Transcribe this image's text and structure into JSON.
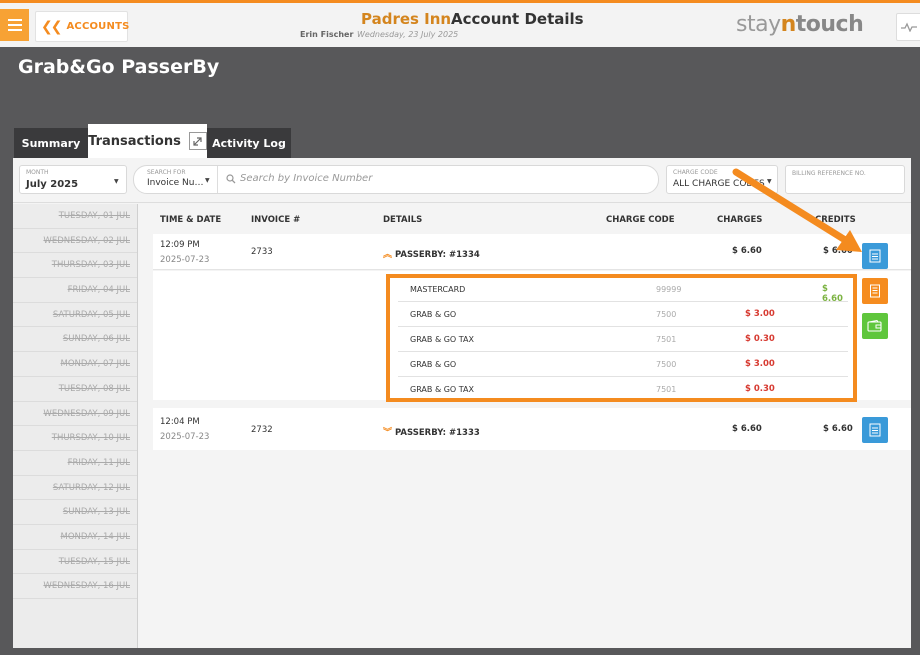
{
  "header": {
    "back_label": "ACCOUNTS",
    "hotel_name": "Padres Inn",
    "page_title": "Account Details",
    "user": "Erin Fischer",
    "date": "Wednesday, 23 July 2025",
    "brand_prefix": "stay",
    "brand_n": "n",
    "brand_suffix": "touch"
  },
  "account": {
    "name": "Grab&Go PasserBy"
  },
  "tabs": [
    {
      "label": "Summary",
      "active": false
    },
    {
      "label": "Transactions",
      "active": true
    },
    {
      "label": "Activity Log",
      "active": false
    }
  ],
  "filters": {
    "month_label": "MONTH",
    "month_value": "July 2025",
    "search_for_label": "SEARCH FOR",
    "search_for_value": "Invoice Nu…",
    "search_placeholder": "Search by Invoice Number",
    "charge_code_label": "CHARGE CODE",
    "charge_code_value": "ALL CHARGE CODES",
    "billing_ref_label": "BILLING REFERENCE NO."
  },
  "days": [
    "TUESDAY, 01 JUL",
    "WEDNESDAY, 02 JUL",
    "THURSDAY, 03 JUL",
    "FRIDAY, 04 JUL",
    "SATURDAY, 05 JUL",
    "SUNDAY, 06 JUL",
    "MONDAY, 07 JUL",
    "TUESDAY, 08 JUL",
    "WEDNESDAY, 09 JUL",
    "THURSDAY, 10 JUL",
    "FRIDAY, 11 JUL",
    "SATURDAY, 12 JUL",
    "SUNDAY, 13 JUL",
    "MONDAY, 14 JUL",
    "TUESDAY, 15 JUL",
    "WEDNESDAY, 16 JUL"
  ],
  "columns": {
    "time": "TIME & DATE",
    "invoice": "INVOICE #",
    "details": "DETAILS",
    "charge_code": "CHARGE CODE",
    "charges": "CHARGES",
    "credits": "CREDITS"
  },
  "transactions": [
    {
      "time": "12:09 PM",
      "date": "2025-07-23",
      "invoice": "2733",
      "details": "PASSERBY: #1334",
      "charges": "$ 6.60",
      "credits": "$ 6.60",
      "expanded": true,
      "items": [
        {
          "label": "MASTERCARD",
          "code": "99999",
          "charge": "",
          "credit": "$ 6.60"
        },
        {
          "label": "GRAB & GO",
          "code": "7500",
          "charge": "$ 3.00",
          "credit": ""
        },
        {
          "label": "GRAB & GO TAX",
          "code": "7501",
          "charge": "$ 0.30",
          "credit": ""
        },
        {
          "label": "GRAB & GO",
          "code": "7500",
          "charge": "$ 3.00",
          "credit": ""
        },
        {
          "label": "GRAB & GO TAX",
          "code": "7501",
          "charge": "$ 0.30",
          "credit": ""
        }
      ]
    },
    {
      "time": "12:04 PM",
      "date": "2025-07-23",
      "invoice": "2732",
      "details": "PASSERBY: #1333",
      "charges": "$ 6.60",
      "credits": "$ 6.60",
      "expanded": false
    }
  ],
  "icons": {
    "menu": "hamburger-icon",
    "back": "double-chevron-left-icon",
    "activity": "pulse-icon",
    "expand": "expand-icon",
    "search": "search-icon",
    "invoice": "invoice-icon",
    "receipt": "receipt-icon",
    "wallet": "wallet-icon"
  },
  "colors": {
    "accent": "#f48b1f",
    "invoice_btn": "#3a9ad9",
    "receipt_btn": "#f58c1f",
    "wallet_btn": "#5fc63c",
    "charge": "#d73a31",
    "credit": "#7cb342"
  }
}
